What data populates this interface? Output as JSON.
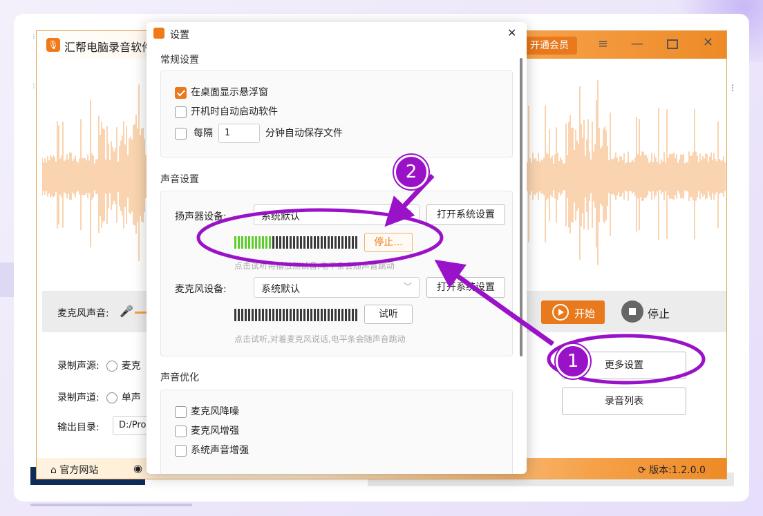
{
  "app": {
    "title": "汇帮电脑录音软件",
    "vip_label": "开通会员",
    "controls": {
      "mic_volume_label": "麦克风声音:",
      "start_label": "开始",
      "stop_label": "停止"
    },
    "options": {
      "source_label": "录制声源:",
      "source_value": "麦克",
      "channel_label": "录制声道:",
      "channel_value": "单声",
      "output_label": "输出目录:",
      "output_value": "D:/Pro"
    },
    "side_buttons": {
      "more_settings": "更多设置",
      "record_list": "录音列表"
    },
    "footer": {
      "website": "官方网站",
      "version": "版本:1.2.0.0"
    }
  },
  "dialog": {
    "title": "设置",
    "general": {
      "title": "常规设置",
      "floating_window": "在桌面显示悬浮窗",
      "floating_window_checked": true,
      "autostart": "开机时自动启动软件",
      "autostart_checked": false,
      "autosave_prefix": "每隔",
      "autosave_value": "1",
      "autosave_suffix": "分钟自动保存文件",
      "autosave_checked": false
    },
    "sound": {
      "title": "声音设置",
      "speaker_label": "扬声器设备:",
      "speaker_value": "系统默认",
      "open_system_settings": "打开系统设置",
      "speaker_test_label": "停止...",
      "speaker_level": 0.3,
      "speaker_hint": "点击试听将播放测试音,电平条会随声音跳动",
      "mic_label": "麦克风设备:",
      "mic_value": "系统默认",
      "mic_test_label": "试听",
      "mic_level": 0,
      "mic_hint": "点击试听,对着麦克风说话,电平条会随声音跳动"
    },
    "optimize": {
      "title": "声音优化",
      "mic_denoise": "麦克风降噪",
      "mic_boost": "麦克风增强",
      "system_boost": "系统声音增强"
    }
  },
  "annotations": {
    "step1": "1",
    "step2": "2"
  },
  "colors": {
    "accent": "#e8791c",
    "annotation": "#9a12c8",
    "meter_active": "#5ccd2a",
    "meter_inactive": "#3a3a3a"
  }
}
